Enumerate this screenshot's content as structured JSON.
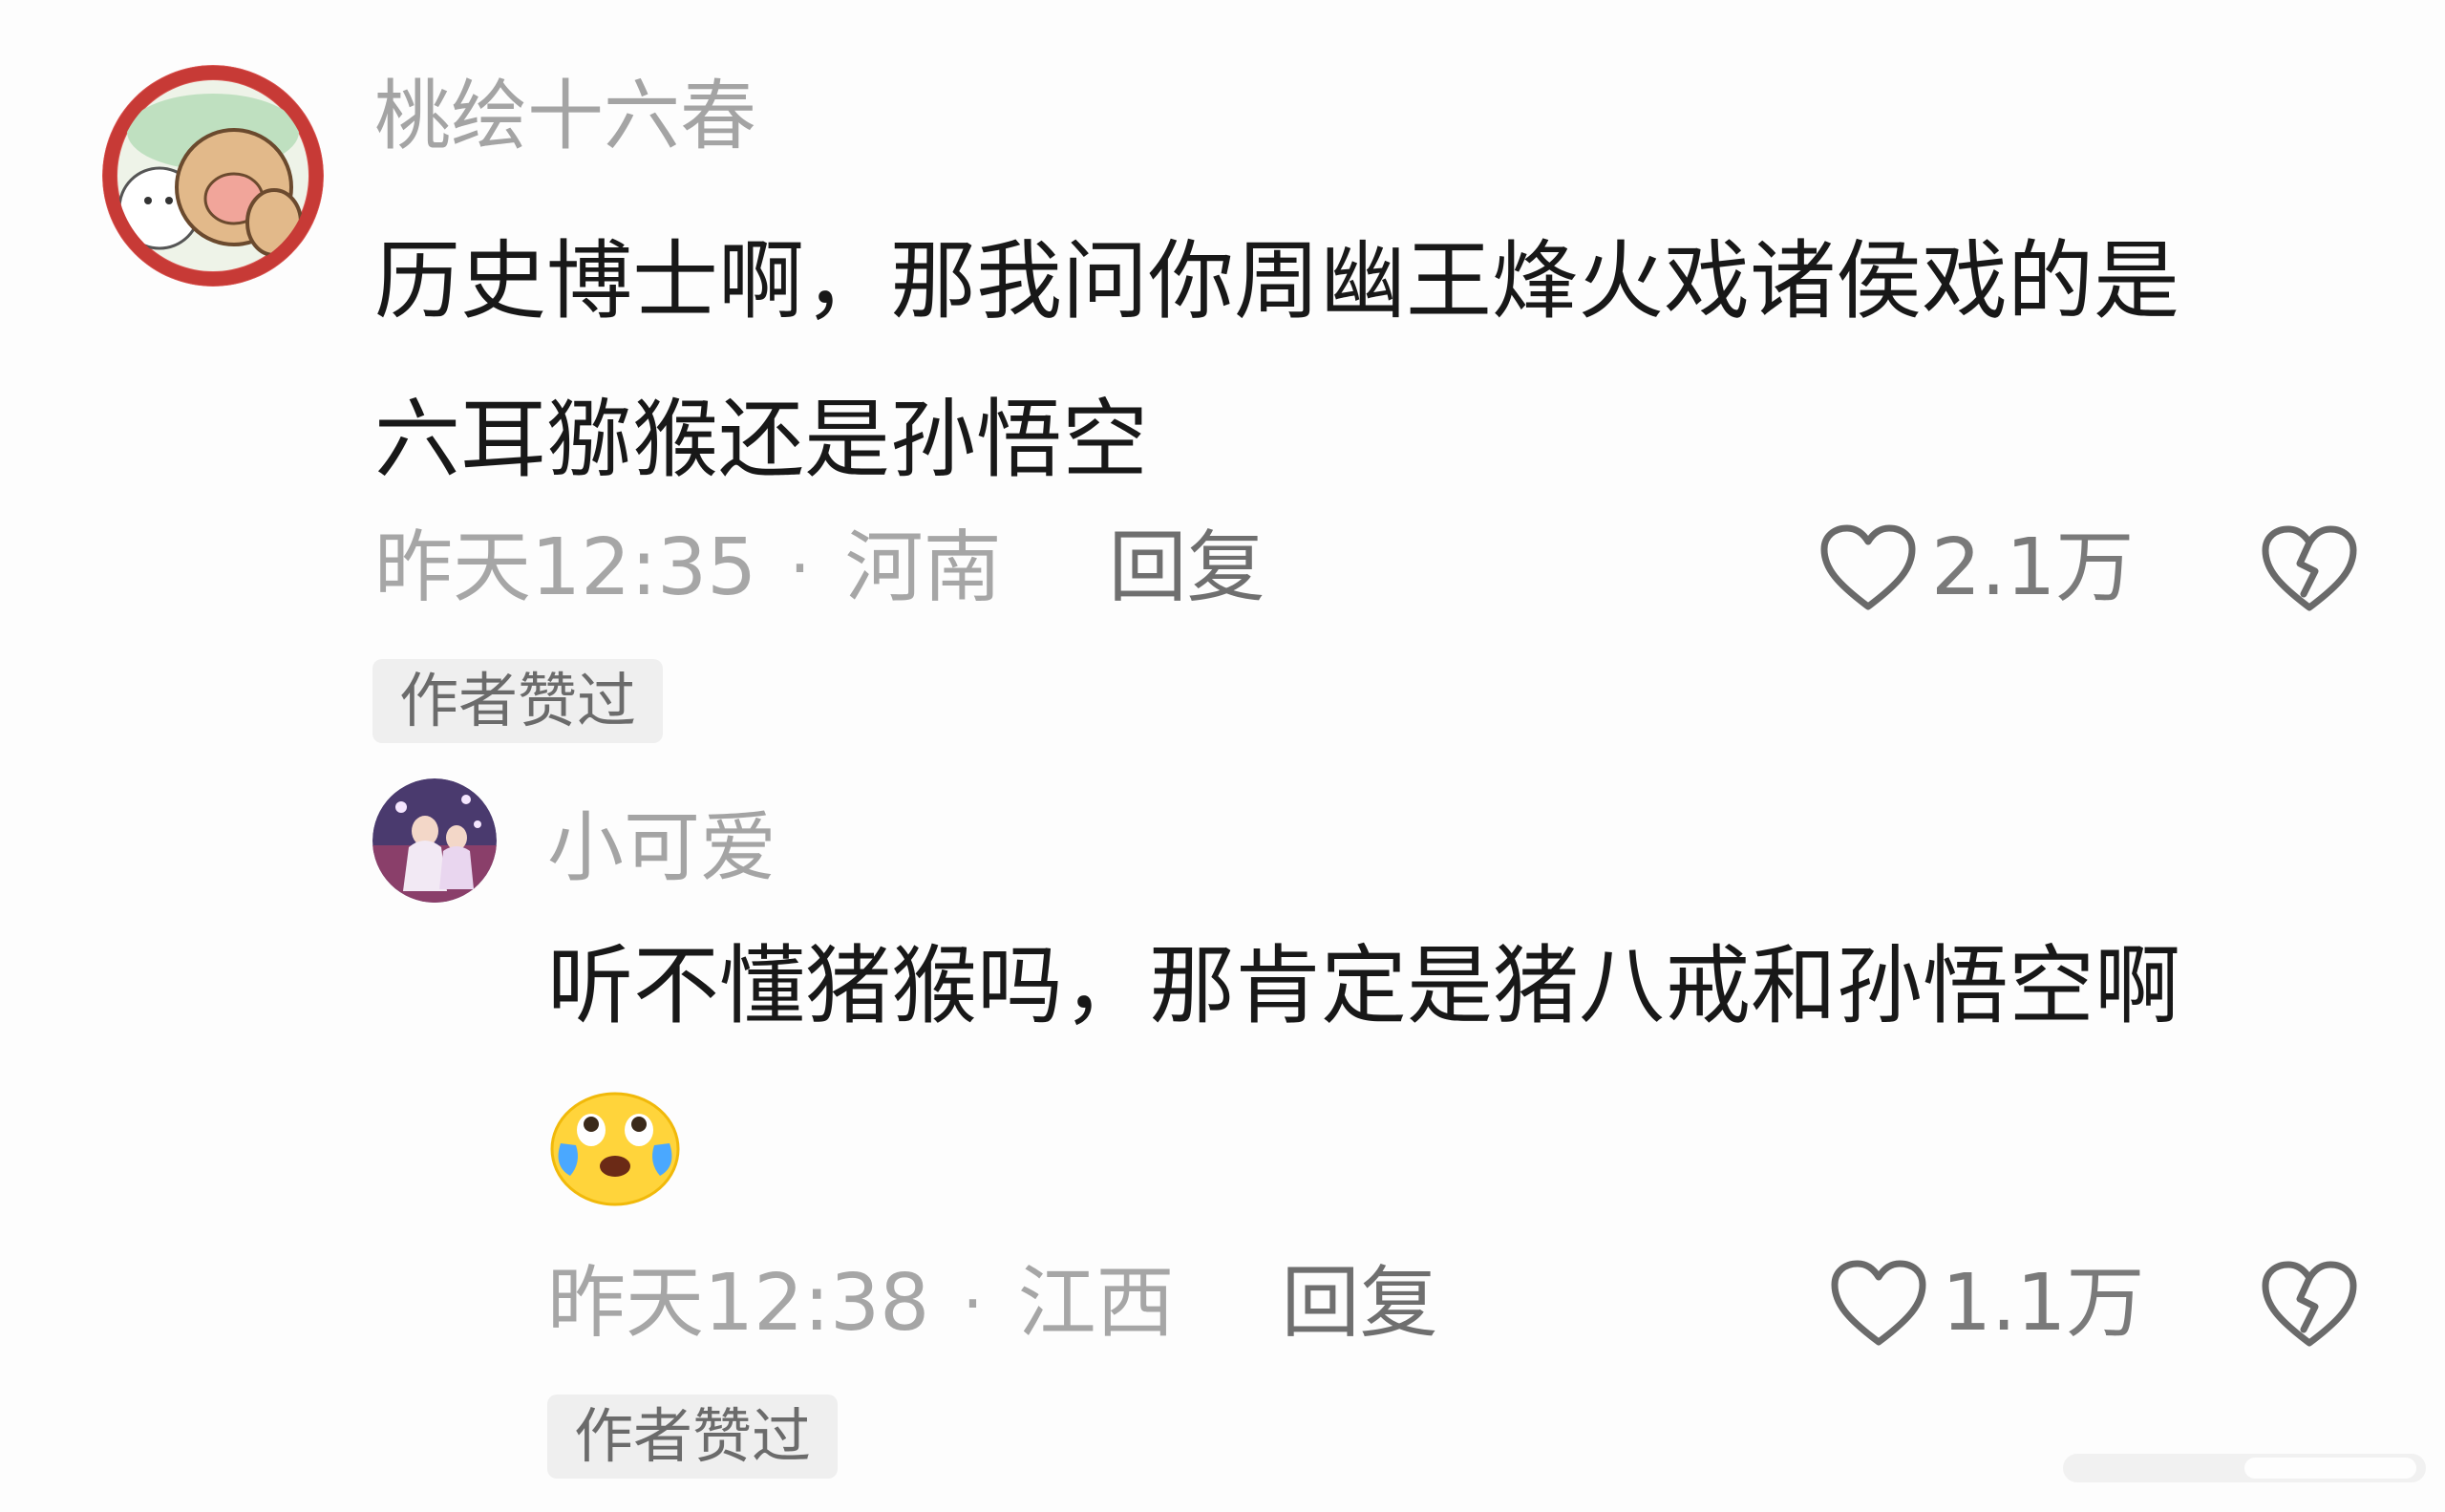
{
  "colors": {
    "background": "#fdfdfd",
    "username": "#a4a4a4",
    "body_text": "#181818",
    "meta_text": "#a6a6a6",
    "reply_text": "#6f6f6f",
    "badge_bg": "#efefef",
    "badge_text": "#6b6b6b"
  },
  "comments": [
    {
      "username": "桃绘十六春",
      "text_lines": [
        "历史博士啊，那我问你周幽王烽火戏诸侯戏的是",
        "六耳猕猴还是孙悟空"
      ],
      "time": "昨天12:35",
      "separator": "·",
      "location": "河南",
      "reply_label": "回复",
      "likes": "2.1万",
      "badge": "作者赞过",
      "icons": {
        "like": "heart-outline-icon",
        "dislike": "broken-heart-icon"
      }
    },
    {
      "username": "小可爱",
      "text": "听不懂猪猴吗，那肯定是猪八戒和孙悟空啊",
      "emoji": "crying-laughing-face-emoji",
      "time": "昨天12:38",
      "separator": "·",
      "location": "江西",
      "reply_label": "回复",
      "likes": "1.1万",
      "badge": "作者赞过",
      "icons": {
        "like": "heart-outline-icon",
        "dislike": "broken-heart-icon"
      }
    }
  ]
}
